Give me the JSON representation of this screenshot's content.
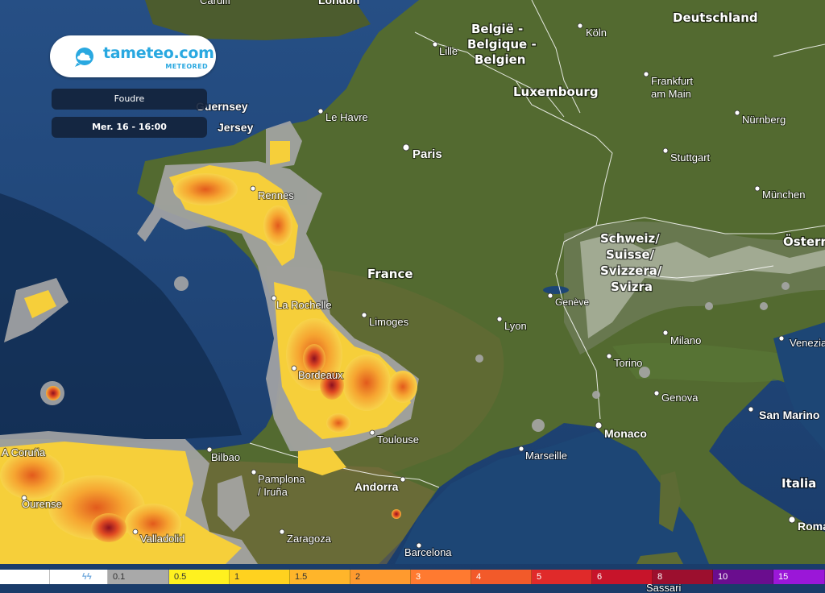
{
  "brand": {
    "name": "tameteo.com",
    "tagline": "METEORED",
    "color": "#29a8e0"
  },
  "controls": {
    "layer": "Foudre",
    "time": "Mer. 16 - 16:00"
  },
  "places": {
    "cardiff": "Cardiff",
    "london": "London",
    "guernsey": "Guernsey",
    "jersey": "Jersey",
    "lehavre": "Le Havre",
    "paris": "Paris",
    "rennes": "Rennes",
    "larochelle": "La Rochelle",
    "limoges": "Limoges",
    "bordeaux": "Bordeaux",
    "toulouse": "Toulouse",
    "lyon": "Lyon",
    "geneve": "Genève",
    "marseille": "Marseille",
    "monaco": "Monaco",
    "andorra": "Andorra",
    "bilbao": "Bilbao",
    "pamplona1": "Pamplona",
    "pamplona2": "/ Iruña",
    "zaragoza": "Zaragoza",
    "barcelona": "Barcelona",
    "valladolid": "Valladolid",
    "ourense": "Ourense",
    "acoruna": "A Coruña",
    "lille": "Lille",
    "koln": "Köln",
    "frankfurt1": "Frankfurt",
    "frankfurt2": "am Main",
    "nurnberg": "Nürnberg",
    "stuttgart": "Stuttgart",
    "munchen": "München",
    "torino": "Torino",
    "milano": "Milano",
    "genova": "Genova",
    "venezia": "Venezia",
    "sanmarino": "San Marino",
    "roma": "Roma",
    "sassari": "Sassari"
  },
  "countries": {
    "belgium1": "België -",
    "belgium2": "Belgique -",
    "belgium3": "Belgien",
    "deutschland": "Deutschland",
    "luxembourg": "Luxembourg",
    "france": "France",
    "swiss1": "Schweiz/",
    "swiss2": "Suisse/",
    "swiss3": "Svizzera/",
    "swiss4": "Svizra",
    "osterreich": "Österr",
    "italia": "Italia"
  },
  "legend": [
    {
      "label": "",
      "color": "#ffffff"
    },
    {
      "label": "ϟϟ",
      "color": "#ffffff",
      "text": "#6fa8dc"
    },
    {
      "label": "0.1",
      "color": "#a9a9a9"
    },
    {
      "label": "0.5",
      "color": "#fff11f"
    },
    {
      "label": "1",
      "color": "#ffd21f"
    },
    {
      "label": "1.5",
      "color": "#ffb52a"
    },
    {
      "label": "2",
      "color": "#ff9a2e"
    },
    {
      "label": "3",
      "color": "#ff7a30"
    },
    {
      "label": "4",
      "color": "#f25a2a"
    },
    {
      "label": "5",
      "color": "#e02a2a"
    },
    {
      "label": "6",
      "color": "#c7142a"
    },
    {
      "label": "8",
      "color": "#9c0f2e"
    },
    {
      "label": "10",
      "color": "#6a0d8e"
    },
    {
      "label": "15",
      "color": "#9b17d8"
    }
  ]
}
